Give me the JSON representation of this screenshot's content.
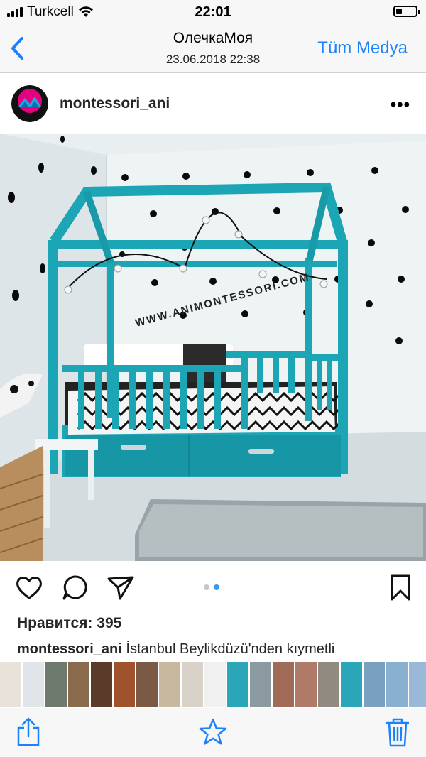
{
  "status": {
    "carrier": "Turkcell",
    "time": "22:01",
    "battery_level": 0.3
  },
  "nav": {
    "title": "ОлечкаМоя",
    "subtitle": "23.06.2018 22:38",
    "right_label": "Tüm Medya",
    "accent": "#1a82fb"
  },
  "post": {
    "username": "montessori_ani",
    "photo_watermark": "WWW.ANIMONTESSORI.COM",
    "page_dots": {
      "count": 2,
      "active_index": 1
    },
    "likes": "Нравится: 395",
    "caption_user": "montessori_ani",
    "caption_text": "İstanbul Beylikdüzü'nden kıymetli"
  },
  "thumbnails": [
    "#e8e2da",
    "#dfe5e8",
    "#6e7a6e",
    "#8a6b4d",
    "#5a3b2a",
    "#a0522d",
    "#7a5a44",
    "#c9b8a0",
    "#d8d2c8",
    "#f0f0f0",
    "#2aa6b8",
    "#8a9aa0",
    "#a06a58",
    "#b07a68",
    "#908a80",
    "#2aa6b8",
    "#7aa0c0",
    "#8ab0d0",
    "#9ab8d8",
    "#b0c8e0",
    "#a8b8c8",
    "#c8a890",
    "#d8c8b8"
  ],
  "icons": [
    "signal-icon",
    "wifi-icon",
    "battery-icon",
    "back-chevron-icon",
    "more-icon",
    "heart-icon",
    "comment-icon",
    "share-icon",
    "bookmark-icon",
    "upload-icon",
    "star-icon",
    "trash-icon"
  ]
}
